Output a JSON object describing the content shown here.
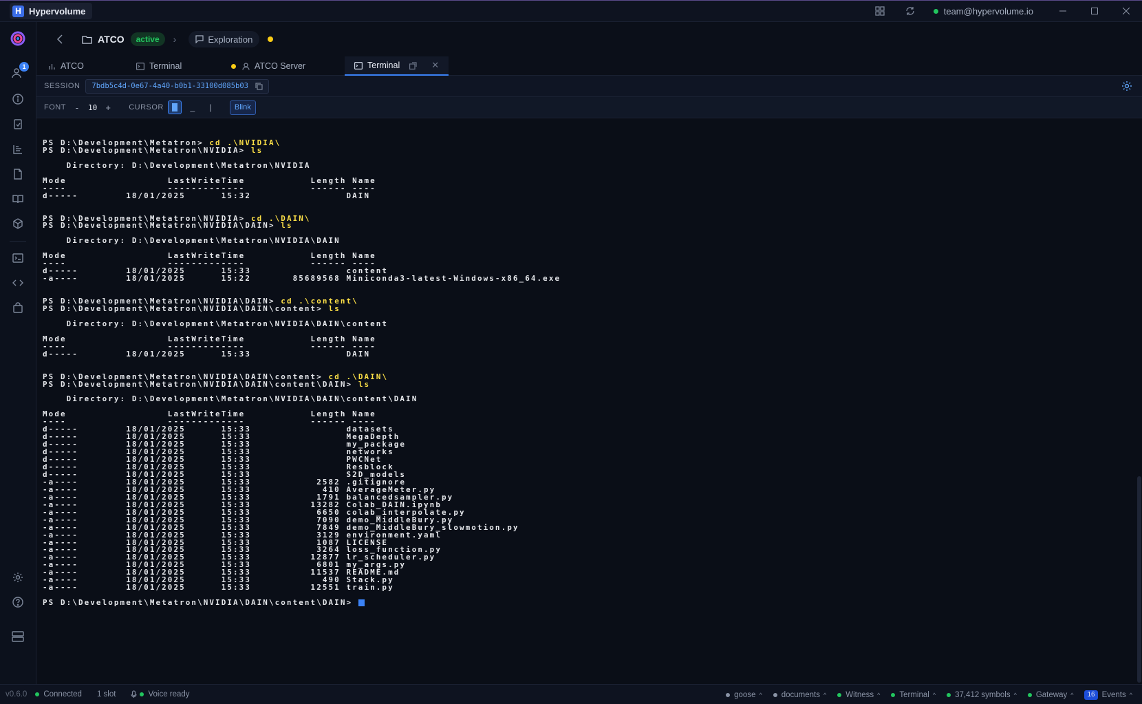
{
  "app": {
    "title": "Hypervolume",
    "logo_letter": "H"
  },
  "titlebar": {
    "account": "team@hypervolume.io",
    "account_status_color": "#22c55e"
  },
  "rail": {
    "users_badge": "1"
  },
  "breadcrumb": {
    "project": "ATCO",
    "status": "active",
    "mode": "Exploration",
    "unsaved_color": "#facc15"
  },
  "tabs": [
    {
      "label": "ATCO",
      "icon": "chart-icon"
    },
    {
      "label": "Terminal",
      "icon": "terminal-icon"
    },
    {
      "label": "ATCO Server",
      "icon": "user-icon",
      "modified": true
    },
    {
      "label": "Terminal",
      "icon": "terminal-icon",
      "active": true
    }
  ],
  "session": {
    "label": "SESSION",
    "id": "7bdb5c4d-0e67-4a40-b0b1-33100d085b03"
  },
  "fontbar": {
    "font_label": "FONT",
    "minus": "-",
    "font_size": "10",
    "plus": "+",
    "cursor_label": "CURSOR",
    "cursor_underline": "_",
    "cursor_bar": "|",
    "blink_label": "Blink"
  },
  "terminal": {
    "blocks": [
      {
        "prompts": [
          {
            "prompt": "PS D:\\Development\\Metatron> ",
            "cmd": "cd .\\NVIDIA\\"
          },
          {
            "prompt": "PS D:\\Development\\Metatron\\NVIDIA> ",
            "cmd": "ls"
          }
        ],
        "directory": "D:\\Development\\Metatron\\NVIDIA",
        "rows": [
          [
            "d-----",
            "18/01/2025",
            "15:32",
            "",
            "DAIN"
          ]
        ]
      },
      {
        "prompts": [
          {
            "prompt": "PS D:\\Development\\Metatron\\NVIDIA> ",
            "cmd": "cd .\\DAIN\\"
          },
          {
            "prompt": "PS D:\\Development\\Metatron\\NVIDIA\\DAIN> ",
            "cmd": "ls"
          }
        ],
        "directory": "D:\\Development\\Metatron\\NVIDIA\\DAIN",
        "rows": [
          [
            "d-----",
            "18/01/2025",
            "15:33",
            "",
            "content"
          ],
          [
            "-a----",
            "18/01/2025",
            "15:22",
            "85689568",
            "Miniconda3-latest-Windows-x86_64.exe"
          ]
        ]
      },
      {
        "prompts": [
          {
            "prompt": "PS D:\\Development\\Metatron\\NVIDIA\\DAIN> ",
            "cmd": "cd .\\content\\"
          },
          {
            "prompt": "PS D:\\Development\\Metatron\\NVIDIA\\DAIN\\content> ",
            "cmd": "ls"
          }
        ],
        "directory": "D:\\Development\\Metatron\\NVIDIA\\DAIN\\content",
        "rows": [
          [
            "d-----",
            "18/01/2025",
            "15:33",
            "",
            "DAIN"
          ]
        ]
      },
      {
        "prompts": [
          {
            "prompt": "PS D:\\Development\\Metatron\\NVIDIA\\DAIN\\content> ",
            "cmd": "cd .\\DAIN\\"
          },
          {
            "prompt": "PS D:\\Development\\Metatron\\NVIDIA\\DAIN\\content\\DAIN> ",
            "cmd": "ls"
          }
        ],
        "directory": "D:\\Development\\Metatron\\NVIDIA\\DAIN\\content\\DAIN",
        "rows": [
          [
            "d-----",
            "18/01/2025",
            "15:33",
            "",
            "datasets"
          ],
          [
            "d-----",
            "18/01/2025",
            "15:33",
            "",
            "MegaDepth"
          ],
          [
            "d-----",
            "18/01/2025",
            "15:33",
            "",
            "my_package"
          ],
          [
            "d-----",
            "18/01/2025",
            "15:33",
            "",
            "networks"
          ],
          [
            "d-----",
            "18/01/2025",
            "15:33",
            "",
            "PWCNet"
          ],
          [
            "d-----",
            "18/01/2025",
            "15:33",
            "",
            "Resblock"
          ],
          [
            "d-----",
            "18/01/2025",
            "15:33",
            "",
            "S2D_models"
          ],
          [
            "-a----",
            "18/01/2025",
            "15:33",
            "2582",
            ".gitignore"
          ],
          [
            "-a----",
            "18/01/2025",
            "15:33",
            "410",
            "AverageMeter.py"
          ],
          [
            "-a----",
            "18/01/2025",
            "15:33",
            "1791",
            "balancedsampler.py"
          ],
          [
            "-a----",
            "18/01/2025",
            "15:33",
            "13282",
            "Colab_DAIN.ipynb"
          ],
          [
            "-a----",
            "18/01/2025",
            "15:33",
            "6650",
            "colab_interpolate.py"
          ],
          [
            "-a----",
            "18/01/2025",
            "15:33",
            "7090",
            "demo_MiddleBury.py"
          ],
          [
            "-a----",
            "18/01/2025",
            "15:33",
            "7849",
            "demo_MiddleBury_slowmotion.py"
          ],
          [
            "-a----",
            "18/01/2025",
            "15:33",
            "3129",
            "environment.yaml"
          ],
          [
            "-a----",
            "18/01/2025",
            "15:33",
            "1087",
            "LICENSE"
          ],
          [
            "-a----",
            "18/01/2025",
            "15:33",
            "3264",
            "loss_function.py"
          ],
          [
            "-a----",
            "18/01/2025",
            "15:33",
            "12877",
            "lr_scheduler.py"
          ],
          [
            "-a----",
            "18/01/2025",
            "15:33",
            "6801",
            "my_args.py"
          ],
          [
            "-a----",
            "18/01/2025",
            "15:33",
            "11537",
            "README.md"
          ],
          [
            "-a----",
            "18/01/2025",
            "15:33",
            "490",
            "Stack.py"
          ],
          [
            "-a----",
            "18/01/2025",
            "15:33",
            "12551",
            "train.py"
          ]
        ]
      }
    ],
    "final_prompt": "PS D:\\Development\\Metatron\\NVIDIA\\DAIN\\content\\DAIN> ",
    "header": {
      "mode": "Mode",
      "time": "LastWriteTime",
      "length": "Length",
      "name": "Name"
    },
    "directory_label": "Directory: "
  },
  "statusbar": {
    "version": "v0.6.0",
    "connection": "Connected",
    "slots": "1 slot",
    "voice": "Voice ready",
    "items": [
      {
        "label": "goose",
        "color": "#8a93a5"
      },
      {
        "label": "documents",
        "color": "#8a93a5"
      },
      {
        "label": "Witness",
        "color": "#22c55e"
      },
      {
        "label": "Terminal",
        "color": "#22c55e"
      },
      {
        "label": "37,412 symbols",
        "color": "#22c55e"
      },
      {
        "label": "Gateway",
        "color": "#22c55e"
      }
    ],
    "events_count": "16",
    "events_label": "Events"
  }
}
